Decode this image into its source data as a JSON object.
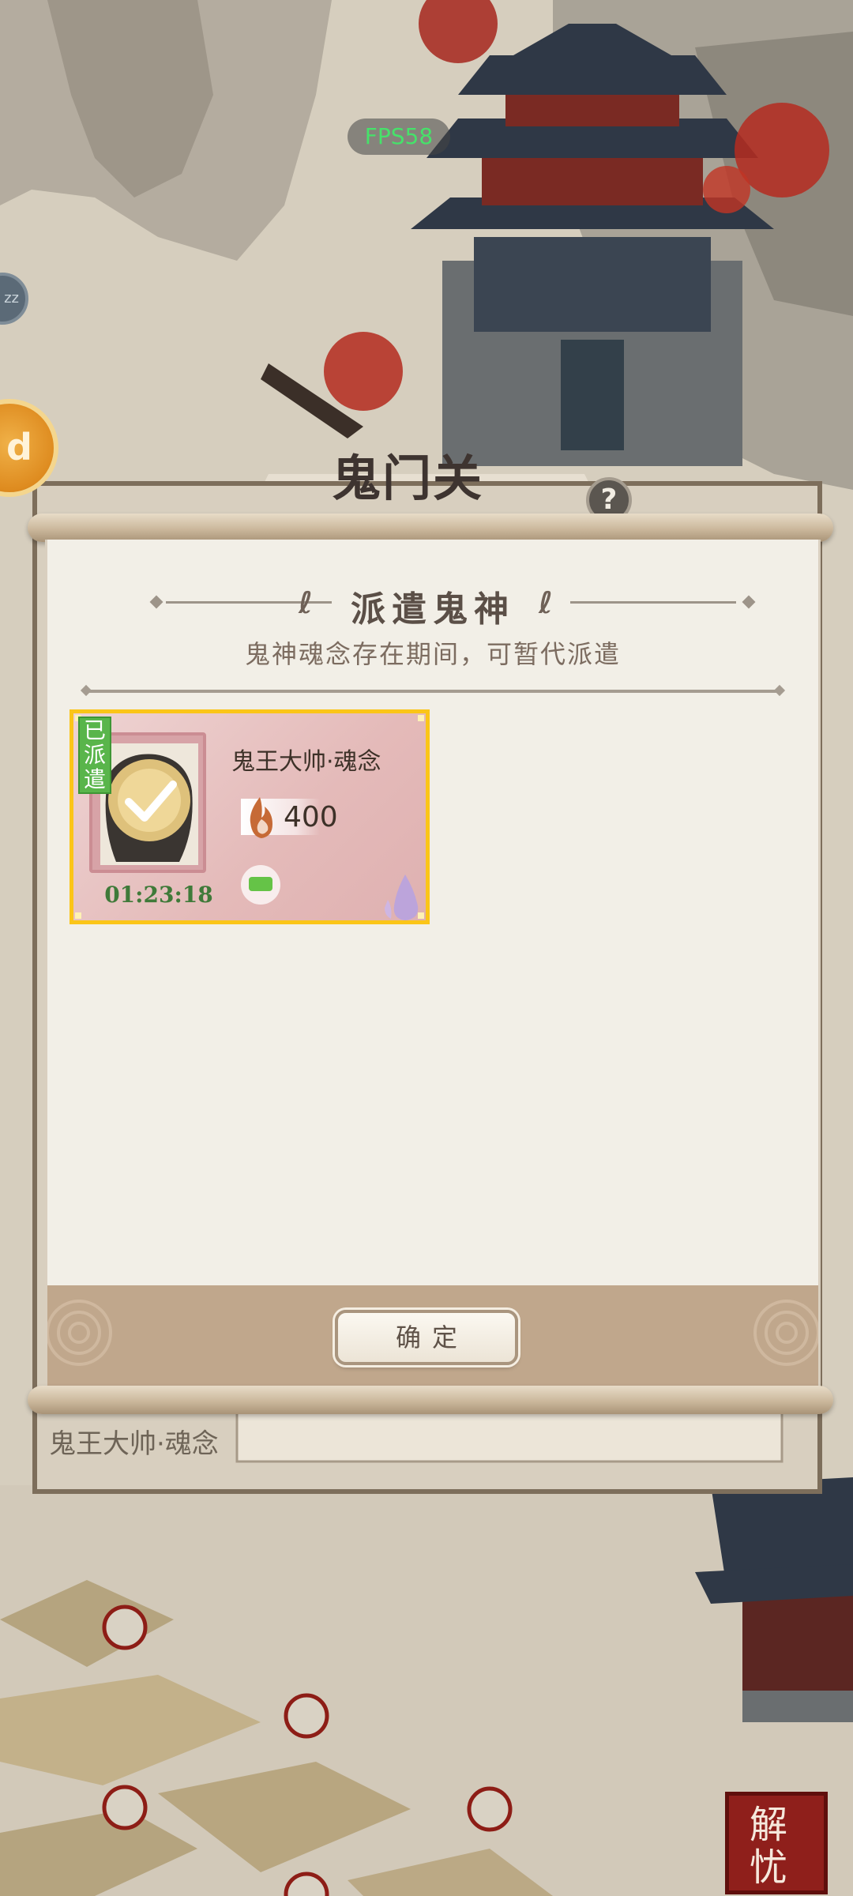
{
  "hud": {
    "fps": "FPS58",
    "zz_label": "zz",
    "location_title": "鬼门关",
    "help_glyph": "?",
    "orange_badge_glyph": "d"
  },
  "dialog": {
    "title": "派遣鬼神",
    "subtitle": "鬼神魂念存在期间，可暂代派遣",
    "confirm_label": "确定"
  },
  "card": {
    "status_tag": "已派遣",
    "name": "鬼王大帅·魂念",
    "cost": "400",
    "timer": "01:23:18"
  },
  "background": {
    "partial_name": "鬼王大帅·魂念",
    "seal_text": "解忧"
  },
  "colors": {
    "card_highlight": "#fbc518",
    "deployed_tag": "#59b54b",
    "timer_text": "#3f7a39",
    "fps_text": "#46e26a",
    "panel_bg": "#f2efe7",
    "panel_footer": "#c0a78c"
  }
}
